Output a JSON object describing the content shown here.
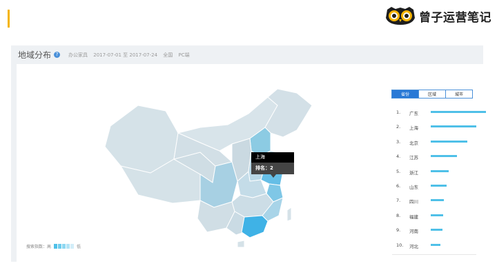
{
  "brand": {
    "name": "曾子运营笔记",
    "logo_icon": "owl-icon"
  },
  "panel": {
    "title": "地域分布",
    "keyword": "办公家具",
    "date_range": "2017-07-01 至 2017-07-24",
    "region": "全国",
    "device": "PC端"
  },
  "tooltip": {
    "region": "上海",
    "rank_text": "排名：2"
  },
  "legend": {
    "high_label": "搜索指数：高",
    "low_label": "低",
    "colors": [
      "#4fc0e8",
      "#6fcdee",
      "#8fd8f2",
      "#b3e4f6",
      "#d3eef9"
    ]
  },
  "tabs": [
    {
      "label": "省份",
      "active": true
    },
    {
      "label": "区域",
      "active": false
    },
    {
      "label": "城市",
      "active": false
    }
  ],
  "ranking": [
    {
      "rank": "1.",
      "name": "广东",
      "value": 100
    },
    {
      "rank": "2.",
      "name": "上海",
      "value": 82
    },
    {
      "rank": "3.",
      "name": "北京",
      "value": 66
    },
    {
      "rank": "4.",
      "name": "江苏",
      "value": 48
    },
    {
      "rank": "5.",
      "name": "浙江",
      "value": 32
    },
    {
      "rank": "6.",
      "name": "山东",
      "value": 29
    },
    {
      "rank": "7.",
      "name": "四川",
      "value": 24
    },
    {
      "rank": "8.",
      "name": "福建",
      "value": 22
    },
    {
      "rank": "9.",
      "name": "河南",
      "value": 21
    },
    {
      "rank": "10.",
      "name": "河北",
      "value": 17
    }
  ]
}
